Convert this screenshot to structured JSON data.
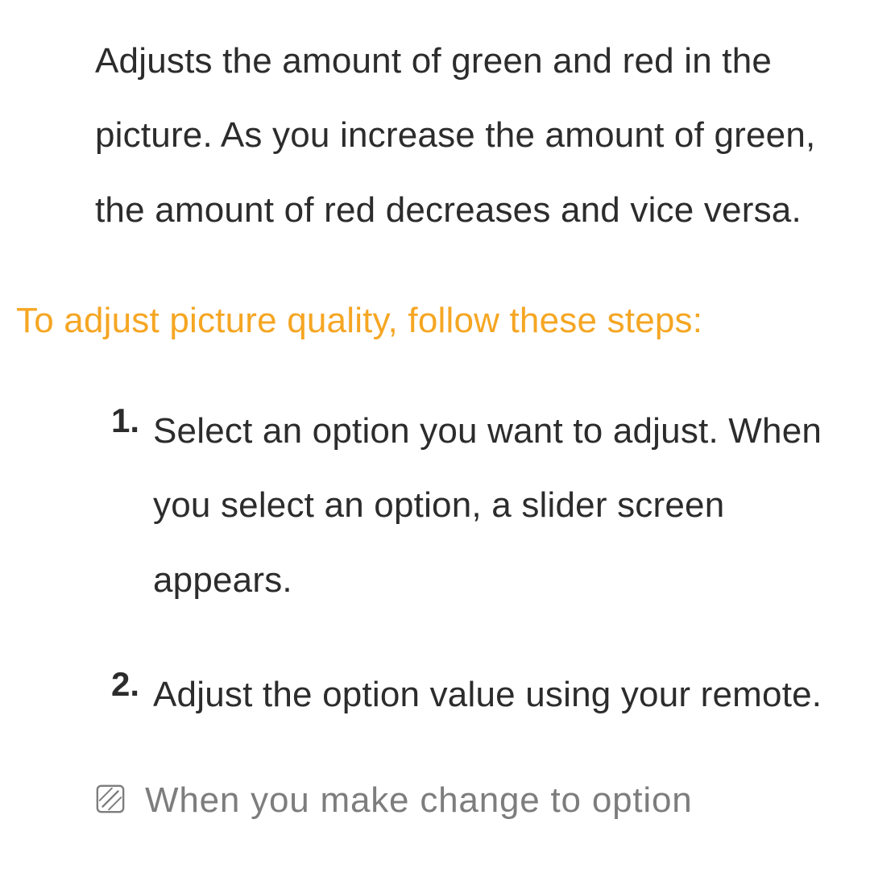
{
  "intro": "Adjusts the amount of green and red in the picture. As you increase the amount of green, the amount of red decreases and vice versa.",
  "heading": "To adjust picture quality, follow these steps:",
  "steps": [
    {
      "num": "1.",
      "text": "Select an option you want to adjust. When you select an option, a slider screen appears."
    },
    {
      "num": "2.",
      "text": "Adjust the option value using your remote."
    }
  ],
  "note": "When you make change to option"
}
